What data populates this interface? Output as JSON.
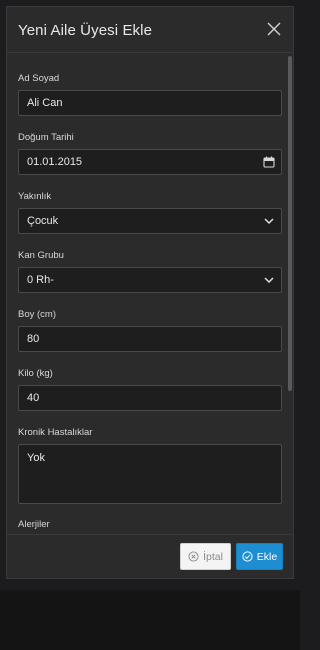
{
  "modal": {
    "title": "Yeni Aile Üyesi Ekle"
  },
  "fields": {
    "name": {
      "label": "Ad Soyad",
      "value": "Ali Can"
    },
    "birth_date": {
      "label": "Doğum Tarihi",
      "value": "01.01.2015"
    },
    "relation": {
      "label": "Yakınlık",
      "value": "Çocuk"
    },
    "blood_type": {
      "label": "Kan Grubu",
      "value": "0 Rh-"
    },
    "height": {
      "label": "Boy (cm)",
      "value": "80"
    },
    "weight": {
      "label": "Kilo (kg)",
      "value": "40"
    },
    "chronic": {
      "label": "Kronik Hastalıklar",
      "value": "Yok"
    },
    "allergies": {
      "label": "Alerjiler"
    }
  },
  "footer": {
    "cancel_label": "İptal",
    "submit_label": "Ekle"
  },
  "colors": {
    "primary": "#1d8ed1",
    "modal_bg": "#2b2b2b",
    "input_bg": "#1e1e1e"
  }
}
